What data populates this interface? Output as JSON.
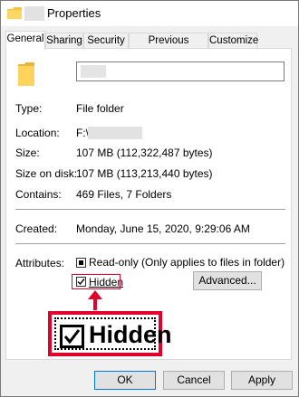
{
  "window": {
    "title": "Properties"
  },
  "tabs": [
    {
      "label": "General"
    },
    {
      "label": "Sharing"
    },
    {
      "label": "Security"
    },
    {
      "label": "Previous Versions"
    },
    {
      "label": "Customize"
    }
  ],
  "general": {
    "type_label": "Type:",
    "type_value": "File folder",
    "location_label": "Location:",
    "location_value": "F:\\",
    "size_label": "Size:",
    "size_value": "107 MB (112,322,487 bytes)",
    "size_on_disk_label": "Size on disk:",
    "size_on_disk_value": "107 MB (113,213,440 bytes)",
    "contains_label": "Contains:",
    "contains_value": "469 Files, 7 Folders",
    "created_label": "Created:",
    "created_value": "Monday, June 15, 2020, 9:29:06 AM",
    "attributes_label": "Attributes:",
    "readonly_label": "Read-only (Only applies to files in folder)",
    "hidden_label": "Hidden",
    "advanced_label": "Advanced..."
  },
  "zoom": {
    "hidden_label": "Hidden"
  },
  "buttons": {
    "ok": "OK",
    "cancel": "Cancel",
    "apply": "Apply"
  },
  "colors": {
    "highlight": "#e0002c",
    "folder": "#f5c542"
  }
}
